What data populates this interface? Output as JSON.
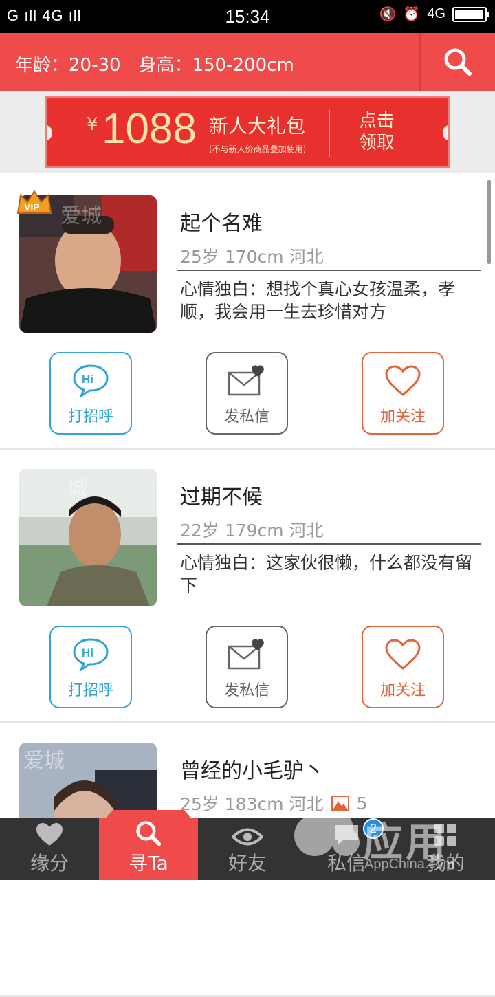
{
  "status_bar": {
    "left": "G ıll 4G ıll",
    "time": "15:34",
    "network": "4G",
    "battery_level": 0.95
  },
  "header": {
    "age_label": "年龄：",
    "age_value": "20-30",
    "height_label": "身高：",
    "height_value": "150-200cm",
    "search_icon": "search-icon"
  },
  "banner": {
    "currency": "¥",
    "amount": "1088",
    "title": "新人大礼包",
    "note": "(不与新人价商品叠加使用)",
    "cta_line1": "点击",
    "cta_line2": "领取"
  },
  "actions": {
    "greet": "打招呼",
    "greet_badge": "Hi",
    "message": "发私信",
    "follow": "加关注"
  },
  "profiles": [
    {
      "name": "起个名难",
      "meta": "25岁 170cm 河北",
      "bio": "心情独白：想找个真心女孩温柔，孝顺，我会用一生去珍惜对方",
      "vip": true,
      "vip_text": "VIP",
      "photo_watermark": "爱城"
    },
    {
      "name": "过期不候",
      "meta": "22岁 179cm 河北",
      "bio": "心情独白：这家伙很懒，什么都没有留下",
      "vip": false,
      "photo_watermark": "城"
    },
    {
      "name": "曾经的小毛驴丶",
      "meta": "25岁 183cm 河北",
      "photo_count": "5",
      "vip": false,
      "photo_watermark": "爱城"
    }
  ],
  "tabs": [
    {
      "label": "缘分",
      "icon": "heart-icon"
    },
    {
      "label": "寻Ta",
      "icon": "search-icon",
      "active": true
    },
    {
      "label": "好友",
      "icon": "eye-icon"
    },
    {
      "label": "私信",
      "icon": "message-icon",
      "badge": "2"
    },
    {
      "label": "我的",
      "icon": "grid-icon"
    }
  ],
  "watermark": {
    "text": "应用汇",
    "sub": "AppChina.com"
  },
  "colors": {
    "brand_red": "#f04b4b",
    "greet_blue": "#33a3d6",
    "follow_orange": "#e0643c",
    "tabbar_bg": "#333333"
  }
}
